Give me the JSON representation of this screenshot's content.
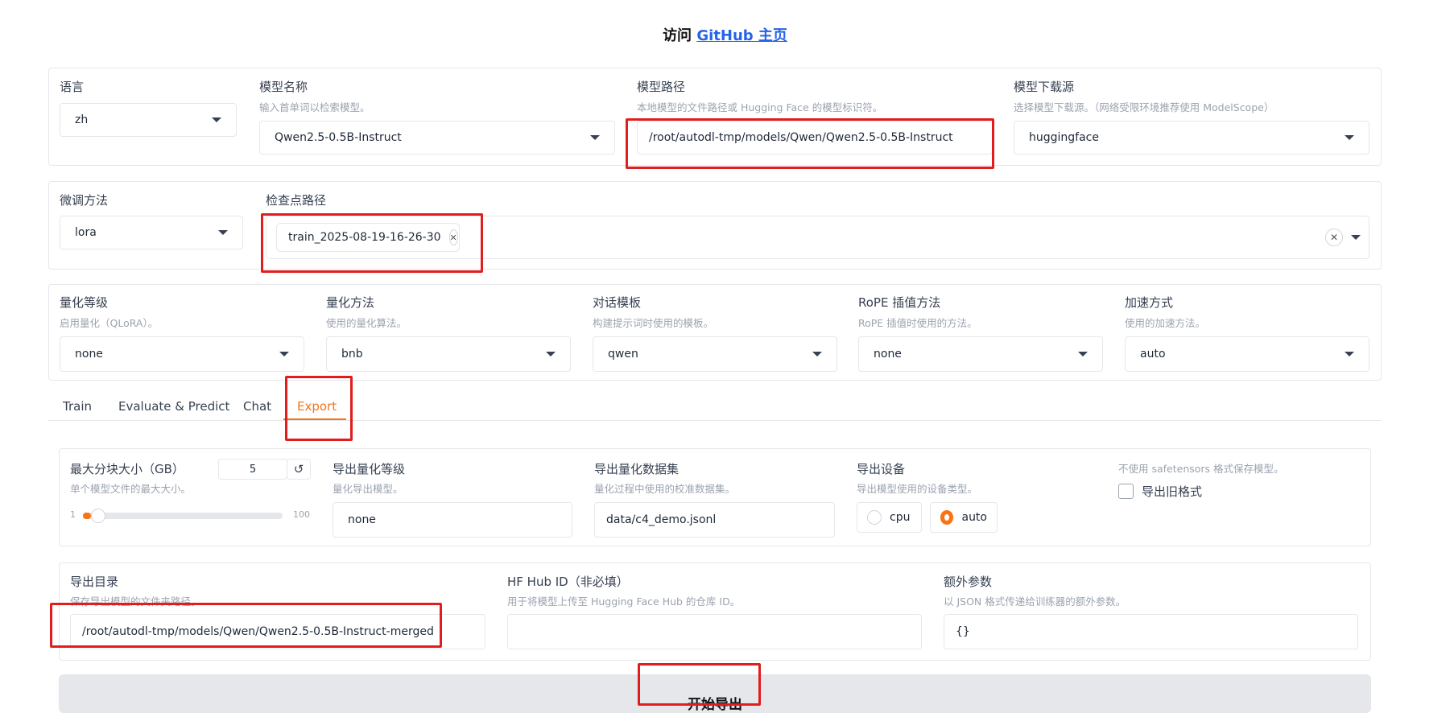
{
  "header": {
    "prefix": "访问",
    "link": "GitHub 主页"
  },
  "row1": {
    "lang": {
      "label": "语言",
      "value": "zh"
    },
    "model_name": {
      "label": "模型名称",
      "sub": "输入首单词以检索模型。",
      "value": "Qwen2.5-0.5B-Instruct"
    },
    "model_path": {
      "label": "模型路径",
      "sub": "本地模型的文件路径或 Hugging Face 的模型标识符。",
      "value": "/root/autodl-tmp/models/Qwen/Qwen2.5-0.5B-Instruct"
    },
    "hub": {
      "label": "模型下载源",
      "sub": "选择模型下载源。（网络受限环境推荐使用 ModelScope）",
      "value": "huggingface"
    }
  },
  "row2": {
    "finetune": {
      "label": "微调方法",
      "value": "lora"
    },
    "checkpoint": {
      "label": "检查点路径",
      "chip": "train_2025-08-19-16-26-30"
    }
  },
  "row3": {
    "quant_bit": {
      "label": "量化等级",
      "sub": "启用量化（QLoRA）。",
      "value": "none"
    },
    "quant_method": {
      "label": "量化方法",
      "sub": "使用的量化算法。",
      "value": "bnb"
    },
    "template": {
      "label": "对话模板",
      "sub": "构建提示词时使用的模板。",
      "value": "qwen"
    },
    "rope": {
      "label": "RoPE 插值方法",
      "sub": "RoPE 插值时使用的方法。",
      "value": "none"
    },
    "booster": {
      "label": "加速方式",
      "sub": "使用的加速方法。",
      "value": "auto"
    }
  },
  "tabs": [
    "Train",
    "Evaluate & Predict",
    "Chat",
    "Export"
  ],
  "export": {
    "shard": {
      "label": "最大分块大小（GB）",
      "sub": "单个模型文件的最大大小。",
      "value": "5",
      "min": "1",
      "max": "100",
      "level": 5
    },
    "quant_bit": {
      "label": "导出量化等级",
      "sub": "量化导出模型。",
      "value": "none"
    },
    "quant_dataset": {
      "label": "导出量化数据集",
      "sub": "量化过程中使用的校准数据集。",
      "value": "data/c4_demo.jsonl"
    },
    "device": {
      "label": "导出设备",
      "sub": "导出模型使用的设备类型。",
      "options": [
        "cpu",
        "auto"
      ],
      "selected": "auto"
    },
    "legacy": {
      "sub": "不使用 safetensors 格式保存模型。",
      "label": "导出旧格式"
    },
    "dir": {
      "label": "导出目录",
      "sub": "保存导出模型的文件夹路径。",
      "value": "/root/autodl-tmp/models/Qwen/Qwen2.5-0.5B-Instruct-merged"
    },
    "hub_id": {
      "label": "HF Hub ID（非必填）",
      "sub": "用于将模型上传至 Hugging Face Hub 的仓库 ID。",
      "value": ""
    },
    "extra": {
      "label": "额外参数",
      "sub": "以 JSON 格式传递给训练器的额外参数。",
      "value": "{}"
    },
    "button": "开始导出"
  },
  "colors": {
    "accent": "#f97316",
    "highlight": "#e11d1d",
    "link": "#2563eb"
  }
}
